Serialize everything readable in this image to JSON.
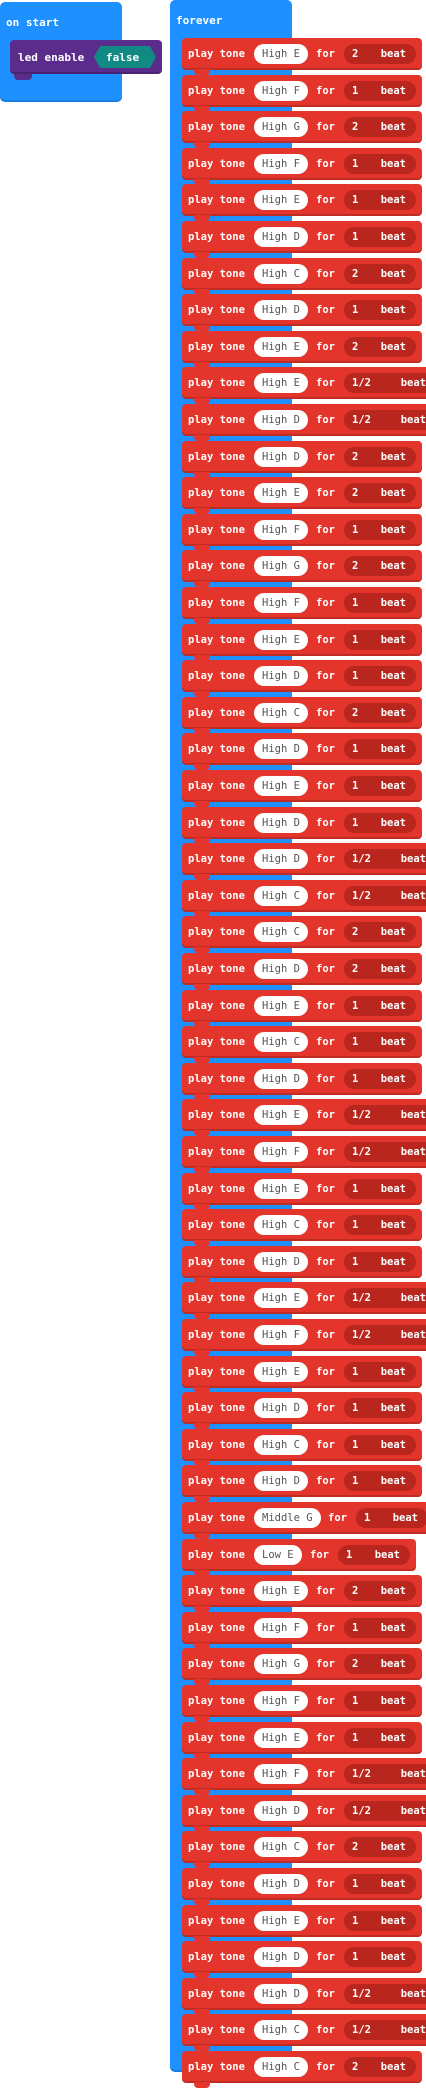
{
  "on_start": {
    "title": "on start",
    "led_label": "led enable",
    "led_value": "false"
  },
  "forever": {
    "title": "forever",
    "play_label": "play tone",
    "for_label": "for",
    "beat_label": "beat",
    "tones": [
      {
        "note": "High E",
        "beats": "2"
      },
      {
        "note": "High F",
        "beats": "1"
      },
      {
        "note": "High G",
        "beats": "2"
      },
      {
        "note": "High F",
        "beats": "1"
      },
      {
        "note": "High E",
        "beats": "1"
      },
      {
        "note": "High D",
        "beats": "1"
      },
      {
        "note": "High C",
        "beats": "2"
      },
      {
        "note": "High D",
        "beats": "1"
      },
      {
        "note": "High E",
        "beats": "2"
      },
      {
        "note": "High E",
        "beats": "1/2"
      },
      {
        "note": "High D",
        "beats": "1/2"
      },
      {
        "note": "High D",
        "beats": "2"
      },
      {
        "note": "High E",
        "beats": "2"
      },
      {
        "note": "High F",
        "beats": "1"
      },
      {
        "note": "High G",
        "beats": "2"
      },
      {
        "note": "High F",
        "beats": "1"
      },
      {
        "note": "High E",
        "beats": "1"
      },
      {
        "note": "High D",
        "beats": "1"
      },
      {
        "note": "High C",
        "beats": "2"
      },
      {
        "note": "High D",
        "beats": "1"
      },
      {
        "note": "High E",
        "beats": "1"
      },
      {
        "note": "High D",
        "beats": "1"
      },
      {
        "note": "High D",
        "beats": "1/2"
      },
      {
        "note": "High C",
        "beats": "1/2"
      },
      {
        "note": "High C",
        "beats": "2"
      },
      {
        "note": "High D",
        "beats": "2"
      },
      {
        "note": "High E",
        "beats": "1"
      },
      {
        "note": "High C",
        "beats": "1"
      },
      {
        "note": "High D",
        "beats": "1"
      },
      {
        "note": "High E",
        "beats": "1/2"
      },
      {
        "note": "High F",
        "beats": "1/2"
      },
      {
        "note": "High E",
        "beats": "1"
      },
      {
        "note": "High C",
        "beats": "1"
      },
      {
        "note": "High D",
        "beats": "1"
      },
      {
        "note": "High E",
        "beats": "1/2"
      },
      {
        "note": "High F",
        "beats": "1/2"
      },
      {
        "note": "High E",
        "beats": "1"
      },
      {
        "note": "High D",
        "beats": "1"
      },
      {
        "note": "High C",
        "beats": "1"
      },
      {
        "note": "High D",
        "beats": "1"
      },
      {
        "note": "Middle G",
        "beats": "1"
      },
      {
        "note": "Low E",
        "beats": "1"
      },
      {
        "note": "High E",
        "beats": "2"
      },
      {
        "note": "High F",
        "beats": "1"
      },
      {
        "note": "High G",
        "beats": "2"
      },
      {
        "note": "High F",
        "beats": "1"
      },
      {
        "note": "High E",
        "beats": "1"
      },
      {
        "note": "High F",
        "beats": "1/2"
      },
      {
        "note": "High D",
        "beats": "1/2"
      },
      {
        "note": "High C",
        "beats": "2"
      },
      {
        "note": "High D",
        "beats": "1"
      },
      {
        "note": "High E",
        "beats": "1"
      },
      {
        "note": "High D",
        "beats": "1"
      },
      {
        "note": "High D",
        "beats": "1/2"
      },
      {
        "note": "High C",
        "beats": "1/2"
      },
      {
        "note": "High C",
        "beats": "2"
      }
    ]
  },
  "colors": {
    "event_blue": "#1e90ff",
    "music_red": "#e3352b",
    "led_purple": "#5a2d8c",
    "boolean_teal": "#128a84"
  }
}
